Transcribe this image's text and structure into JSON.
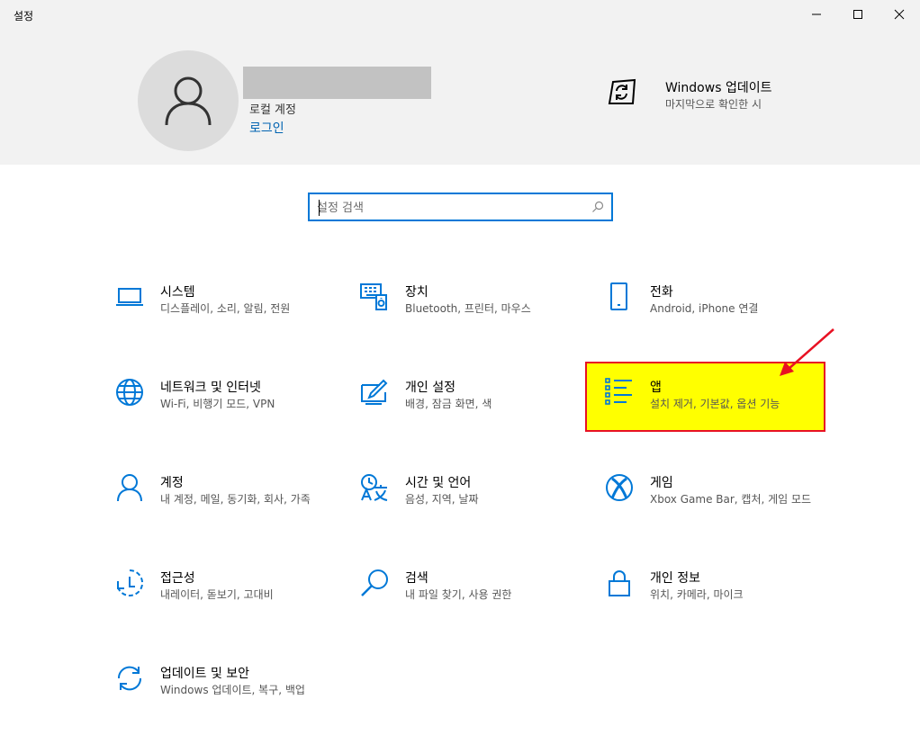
{
  "window": {
    "title": "설정"
  },
  "header": {
    "account_type": "로컬 계정",
    "signin_label": "로그인",
    "update_title": "Windows 업데이트",
    "update_subtitle": "마지막으로 확인한 시"
  },
  "search": {
    "placeholder": "설정 검색"
  },
  "tiles": [
    {
      "name": "시스템",
      "desc": "디스플레이, 소리, 알림, 전원",
      "icon": "laptop-icon"
    },
    {
      "name": "장치",
      "desc": "Bluetooth, 프린터, 마우스",
      "icon": "devices-icon"
    },
    {
      "name": "전화",
      "desc": "Android, iPhone 연결",
      "icon": "phone-icon"
    },
    {
      "name": "네트워크 및 인터넷",
      "desc": "Wi-Fi, 비행기 모드, VPN",
      "icon": "globe-icon"
    },
    {
      "name": "개인 설정",
      "desc": "배경, 잠금 화면, 색",
      "icon": "personalization-icon"
    },
    {
      "name": "앱",
      "desc": "설치 제거, 기본값, 옵션 기능",
      "icon": "apps-list-icon"
    },
    {
      "name": "계정",
      "desc": "내 계정, 메일, 동기화, 회사, 가족",
      "icon": "person-icon"
    },
    {
      "name": "시간 및 언어",
      "desc": "음성, 지역, 날짜",
      "icon": "time-language-icon"
    },
    {
      "name": "게임",
      "desc": "Xbox Game Bar, 캡처, 게임 모드",
      "icon": "xbox-icon"
    },
    {
      "name": "접근성",
      "desc": "내레이터, 돋보기, 고대비",
      "icon": "ease-of-access-icon"
    },
    {
      "name": "검색",
      "desc": "내 파일 찾기, 사용 권한",
      "icon": "search-icon"
    },
    {
      "name": "개인 정보",
      "desc": "위치, 카메라, 마이크",
      "icon": "lock-icon"
    },
    {
      "name": "업데이트 및 보안",
      "desc": "Windows 업데이트, 복구, 백업",
      "icon": "sync-icon"
    }
  ],
  "annotation": {
    "highlight_color": "#ffff00",
    "border_color": "#e81123",
    "arrow_color": "#e81123"
  },
  "colors": {
    "accent": "#0078d7",
    "link": "#0063b1",
    "header_bg": "#f2f2f2"
  }
}
